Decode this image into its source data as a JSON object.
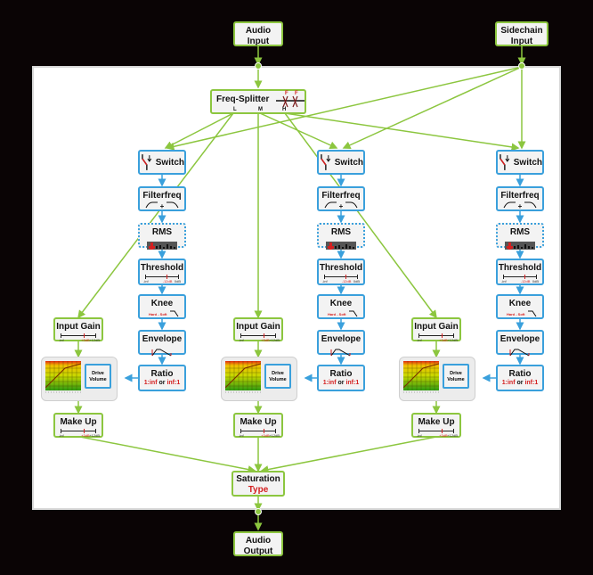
{
  "io": {
    "audio_input": [
      "Audio",
      "Input"
    ],
    "sidechain_input": [
      "Sidechain",
      "Input"
    ],
    "audio_output": [
      "Audio",
      "Output"
    ]
  },
  "splitter": {
    "title": "Freq-Splitter",
    "band_labels": [
      "L",
      "M",
      "H"
    ],
    "freq_marker": "F"
  },
  "detector_chain": {
    "switch": "Switch",
    "filterfreq": "Filterfreq",
    "filter_plus": "+",
    "filter_marker": "F",
    "rms": "RMS",
    "threshold": "Threshold",
    "threshold_scale": [
      "-inf",
      "-12dB",
      "0dB"
    ],
    "knee": "Knee",
    "knee_sub": "Hard - Soft",
    "envelope": "Envelope",
    "envelope_markers": [
      "A",
      "R"
    ],
    "ratio": "Ratio",
    "ratio_left": "1:inf",
    "ratio_or": "or",
    "ratio_right": "inf:1"
  },
  "gain_chain": {
    "input_gain": "Input Gain",
    "gain_scale": [
      "-inf",
      "+3dB",
      "+12dB"
    ],
    "drive_volume": [
      "Drive",
      "Volume"
    ],
    "make_up": "Make Up",
    "makeup_scale": [
      "-inf",
      "+3dB",
      "+12dB"
    ]
  },
  "saturation": {
    "title": "Saturation",
    "type": "Type"
  },
  "colors": {
    "audio_wire": "#8cc63f",
    "control_wire": "#3aa0dc",
    "accent_red": "#d42020",
    "background": "#0a0405"
  }
}
